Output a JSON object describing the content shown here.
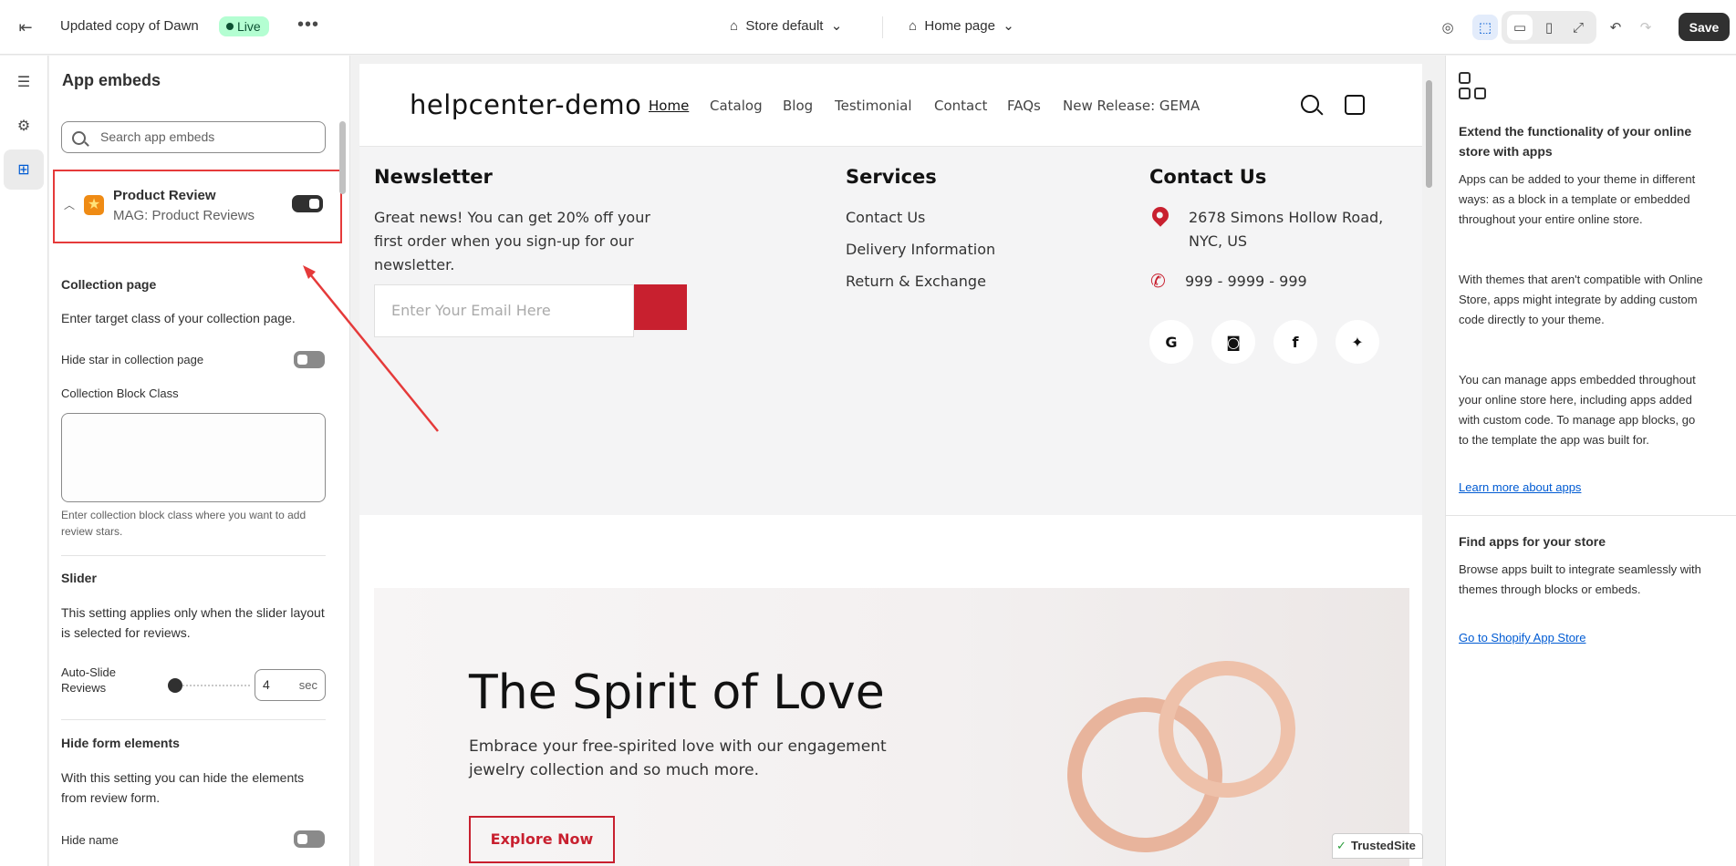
{
  "topbar": {
    "theme_title": "Updated copy of Dawn",
    "live_badge": "Live",
    "more_label": "•••",
    "store_selector": "Store default",
    "page_selector": "Home page",
    "save_label": "Save"
  },
  "left_panel": {
    "title": "App embeds",
    "search_placeholder": "Search app embeds",
    "embed": {
      "name": "Product Review",
      "app": "MAG: Product Reviews",
      "enabled": true
    },
    "collection": {
      "heading": "Collection page",
      "description": "Enter target class of your collection page.",
      "hide_star_label": "Hide star in collection page",
      "hide_star_enabled": false,
      "block_class_label": "Collection Block Class",
      "block_class_value": "",
      "block_class_help": "Enter collection block class where you want to add review stars."
    },
    "slider": {
      "heading": "Slider",
      "description": "This setting applies only when the slider layout is selected for reviews.",
      "auto_slide_label": "Auto-Slide Reviews",
      "auto_slide_value": "4",
      "auto_slide_unit": "sec"
    },
    "hide_form": {
      "heading": "Hide form elements",
      "description": "With this setting you can hide the elements from review form.",
      "hide_name_label": "Hide name",
      "hide_name_enabled": false
    }
  },
  "preview": {
    "logo": "helpcenter-demo",
    "nav": [
      "Home",
      "Catalog",
      "Blog",
      "Testimonial",
      "Contact",
      "FAQs",
      "New Release: GEMA"
    ],
    "newsletter": {
      "heading": "Newsletter",
      "text": "Great news! You can get 20% off your first order when you sign-up for our newsletter.",
      "email_placeholder": "Enter Your Email Here"
    },
    "services": {
      "heading": "Services",
      "links": [
        "Contact Us",
        "Delivery Information",
        "Return & Exchange"
      ]
    },
    "contact": {
      "heading": "Contact Us",
      "address": "2678 Simons Hollow Road, NYC, US",
      "phone": "999 - 9999 - 999"
    },
    "banner": {
      "heading": "The Spirit of Love",
      "text": "Embrace your free-spirited love with our engagement jewelry collection and so much more.",
      "button": "Explore Now"
    },
    "trusted_badge": "TrustedSite"
  },
  "right_panel": {
    "heading": "Extend the functionality of your online store with apps",
    "para1": "Apps can be added to your theme in different ways: as a block in a template or embedded throughout your entire online store.",
    "para2": "With themes that aren't compatible with Online Store, apps might integrate by adding custom code directly to your theme.",
    "para3": "You can manage apps embedded throughout your online store here, including apps added with custom code. To manage app blocks, go to the template the app was built for.",
    "link1": "Learn more about apps",
    "find_heading": "Find apps for your store",
    "find_text": "Browse apps built to integrate seamlessly with themes through blocks or embeds.",
    "link2": "Go to Shopify App Store"
  },
  "colors": {
    "accent_red": "#c8202f",
    "highlight_box": "#e53a3a",
    "live_badge_bg": "#b4fed2",
    "link_blue": "#005bd3"
  }
}
